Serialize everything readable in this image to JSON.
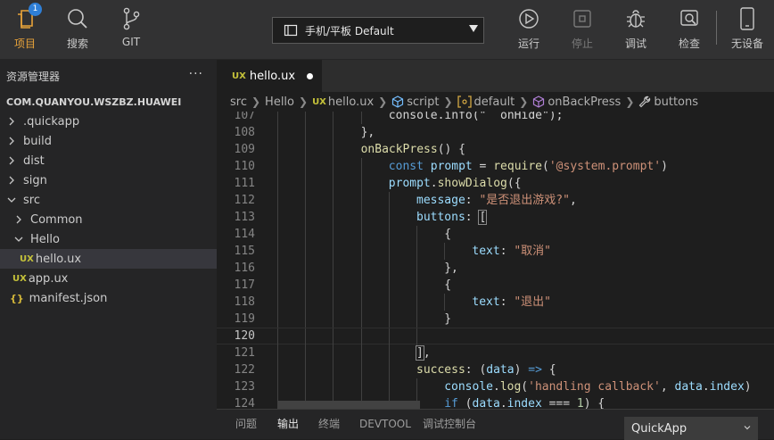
{
  "toolbar": {
    "project": "项目",
    "project_badge": "1",
    "search": "搜索",
    "git": "GIT",
    "device": "手机/平板 Default",
    "run": "运行",
    "stop": "停止",
    "debug": "调试",
    "inspect": "检查",
    "no_device": "无设备"
  },
  "sidebar": {
    "title": "资源管理器",
    "more": "···",
    "project_name": "COM.QUANYOU.WSZBZ.HUAWEI",
    "items": [
      {
        "label": ".quickapp"
      },
      {
        "label": "build"
      },
      {
        "label": "dist"
      },
      {
        "label": "sign"
      },
      {
        "label": "src"
      },
      {
        "label": "Common"
      },
      {
        "label": "Hello"
      },
      {
        "label": "hello.ux"
      },
      {
        "label": "app.ux"
      },
      {
        "label": "manifest.json"
      }
    ]
  },
  "tab": {
    "label": "hello.ux"
  },
  "breadcrumb": [
    "src",
    "Hello",
    "hello.ux",
    "script",
    "default",
    "onBackPress",
    "buttons"
  ],
  "editor": {
    "current_line": 120,
    "lines": [
      {
        "n": "107",
        "tokens": [
          {
            "t": "console.info(\"  onHide\");",
            "c": "pun"
          }
        ]
      },
      {
        "n": "108",
        "tokens": [
          {
            "t": "},",
            "c": "pun"
          }
        ]
      },
      {
        "n": "109",
        "tokens": [
          {
            "t": "onBackPress",
            "c": "fn"
          },
          {
            "t": "() {",
            "c": "pun"
          }
        ]
      },
      {
        "n": "110",
        "tokens": [
          {
            "t": "const ",
            "c": "kw"
          },
          {
            "t": "prompt",
            "c": "var"
          },
          {
            "t": " = ",
            "c": "pun"
          },
          {
            "t": "require",
            "c": "fn"
          },
          {
            "t": "(",
            "c": "pun"
          },
          {
            "t": "'@system.prompt'",
            "c": "str"
          },
          {
            "t": ")",
            "c": "pun"
          }
        ]
      },
      {
        "n": "111",
        "tokens": [
          {
            "t": "prompt",
            "c": "var"
          },
          {
            "t": ".",
            "c": "pun"
          },
          {
            "t": "showDialog",
            "c": "fn"
          },
          {
            "t": "({",
            "c": "pun"
          }
        ]
      },
      {
        "n": "112",
        "tokens": [
          {
            "t": "message",
            "c": "var"
          },
          {
            "t": ": ",
            "c": "pun"
          },
          {
            "t": "\"是否退出游戏?\"",
            "c": "str"
          },
          {
            "t": ",",
            "c": "pun"
          }
        ]
      },
      {
        "n": "113",
        "tokens": [
          {
            "t": "buttons",
            "c": "var"
          },
          {
            "t": ": ",
            "c": "pun"
          },
          {
            "t": "[",
            "c": "brk"
          }
        ]
      },
      {
        "n": "114",
        "tokens": [
          {
            "t": "{",
            "c": "pun"
          }
        ]
      },
      {
        "n": "115",
        "tokens": [
          {
            "t": "text",
            "c": "var"
          },
          {
            "t": ": ",
            "c": "pun"
          },
          {
            "t": "\"取消\"",
            "c": "str"
          }
        ]
      },
      {
        "n": "116",
        "tokens": [
          {
            "t": "},",
            "c": "pun"
          }
        ]
      },
      {
        "n": "117",
        "tokens": [
          {
            "t": "{",
            "c": "pun"
          }
        ]
      },
      {
        "n": "118",
        "tokens": [
          {
            "t": "text",
            "c": "var"
          },
          {
            "t": ": ",
            "c": "pun"
          },
          {
            "t": "\"退出\"",
            "c": "str"
          }
        ]
      },
      {
        "n": "119",
        "tokens": [
          {
            "t": "}",
            "c": "pun"
          }
        ]
      },
      {
        "n": "120",
        "tokens": []
      },
      {
        "n": "121",
        "tokens": [
          {
            "t": "]",
            "c": "brk"
          },
          {
            "t": ",",
            "c": "pun"
          }
        ]
      },
      {
        "n": "122",
        "tokens": [
          {
            "t": "success",
            "c": "fn"
          },
          {
            "t": ": (",
            "c": "pun"
          },
          {
            "t": "data",
            "c": "var"
          },
          {
            "t": ") ",
            "c": "pun"
          },
          {
            "t": "=>",
            "c": "kw"
          },
          {
            "t": " {",
            "c": "pun"
          }
        ]
      },
      {
        "n": "123",
        "tokens": [
          {
            "t": "console",
            "c": "var"
          },
          {
            "t": ".",
            "c": "pun"
          },
          {
            "t": "log",
            "c": "fn"
          },
          {
            "t": "(",
            "c": "pun"
          },
          {
            "t": "'handling callback'",
            "c": "str"
          },
          {
            "t": ", ",
            "c": "pun"
          },
          {
            "t": "data",
            "c": "var"
          },
          {
            "t": ".",
            "c": "pun"
          },
          {
            "t": "index",
            "c": "var"
          },
          {
            "t": ")",
            "c": "pun"
          }
        ]
      },
      {
        "n": "124",
        "tokens": [
          {
            "t": "if",
            "c": "kw"
          },
          {
            "t": " (",
            "c": "pun"
          },
          {
            "t": "data",
            "c": "var"
          },
          {
            "t": ".",
            "c": "pun"
          },
          {
            "t": "index",
            "c": "var"
          },
          {
            "t": " === ",
            "c": "pun"
          },
          {
            "t": "1",
            "c": "num"
          },
          {
            "t": ") {",
            "c": "pun"
          }
        ]
      }
    ]
  },
  "panel": {
    "tabs": [
      "问题",
      "输出",
      "终端",
      "DEVTOOL",
      "调试控制台"
    ],
    "active": "输出",
    "channel": "QuickApp"
  }
}
